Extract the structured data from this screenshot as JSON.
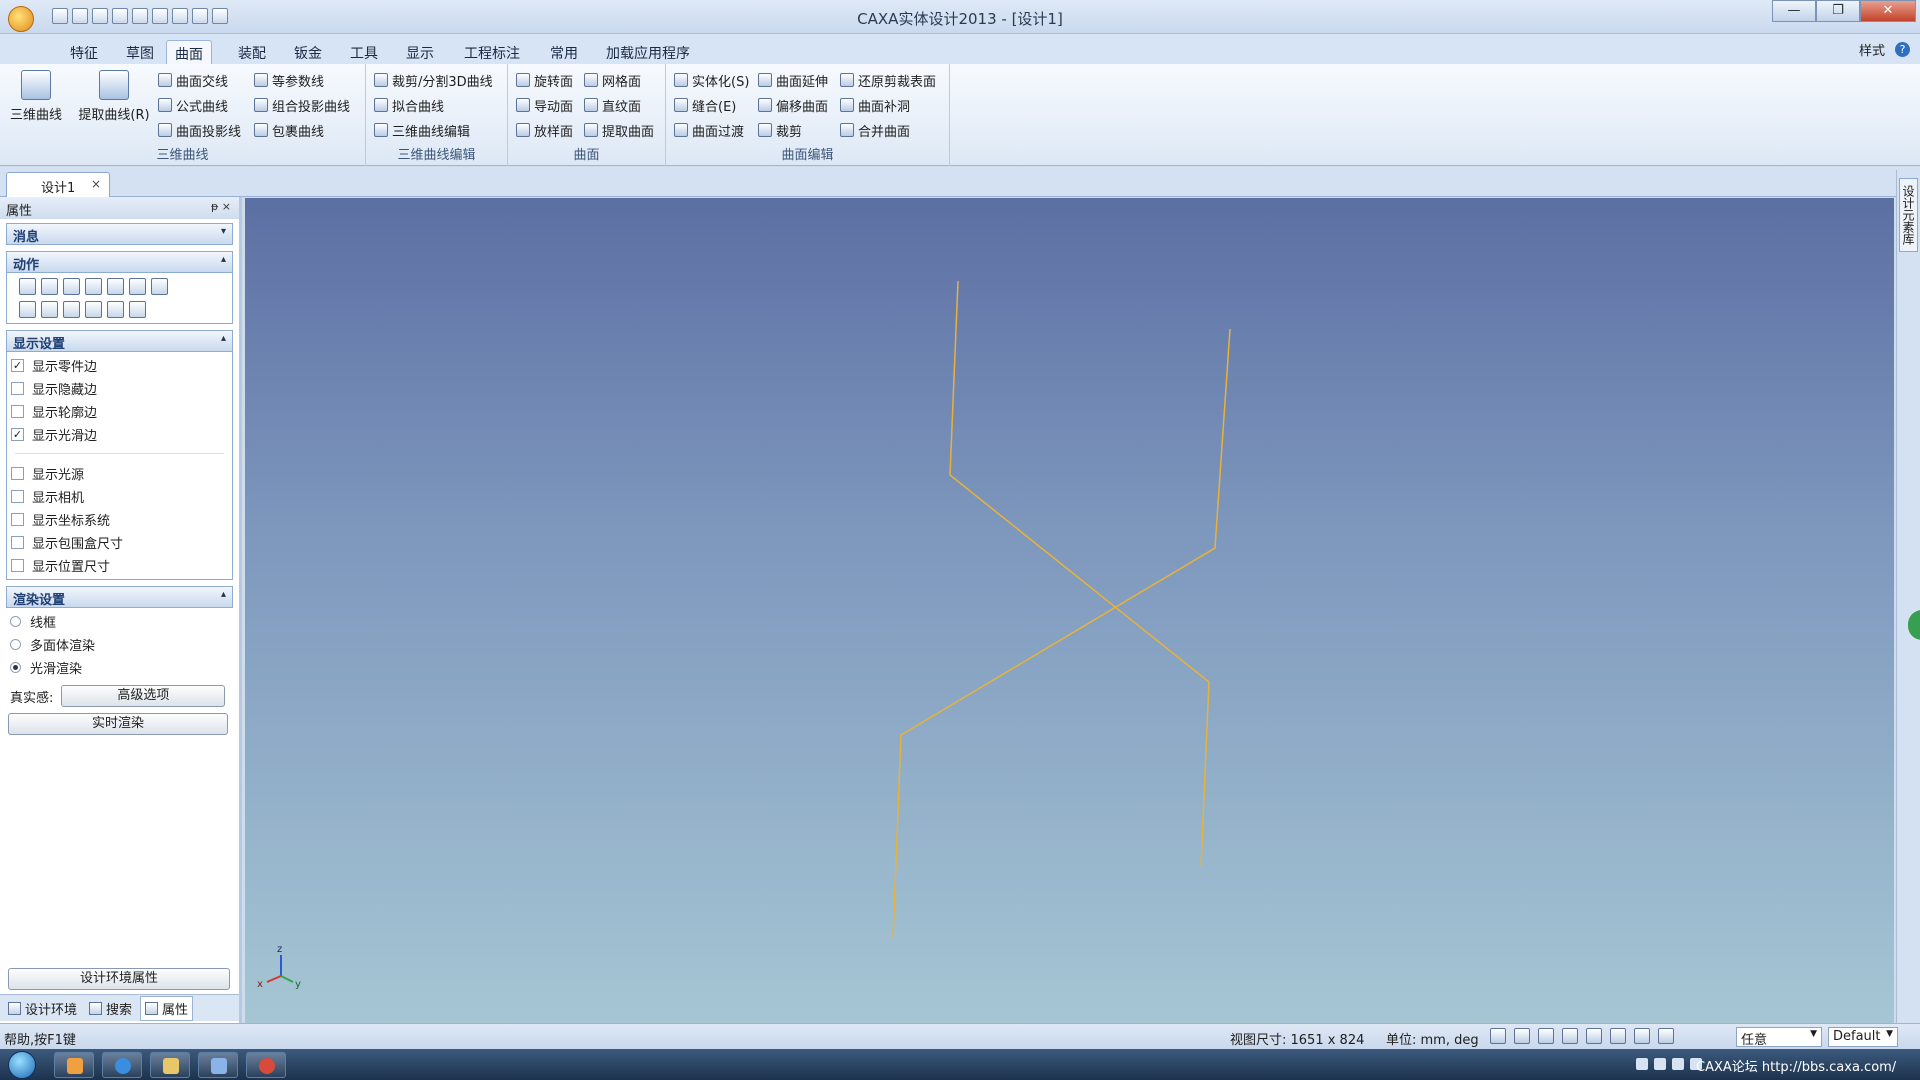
{
  "window": {
    "title": "CAXA实体设计2013 - [设计1]",
    "controls": {
      "minimize": "—",
      "maximize": "❐",
      "close": "✕"
    }
  },
  "ribbon": {
    "tabs": [
      "特征",
      "草图",
      "曲面",
      "装配",
      "钣金",
      "工具",
      "显示",
      "工程标注",
      "常用",
      "加载应用程序"
    ],
    "active_tab": "曲面",
    "right": {
      "style_label": "样式",
      "help": "?"
    },
    "groups": {
      "curve3d": {
        "title": "三维曲线",
        "big": [
          "三维曲线",
          "提取曲线(R)"
        ],
        "small": [
          "曲面交线",
          "等参数线",
          "公式曲线",
          "组合投影曲线",
          "曲面投影线",
          "包裹曲线"
        ]
      },
      "curve_edit": {
        "title": "三维曲线编辑",
        "small": [
          "裁剪/分割3D曲线",
          "拟合曲线",
          "三维曲线编辑"
        ]
      },
      "surface": {
        "title": "曲面",
        "small": [
          "旋转面",
          "网格面",
          "导动面",
          "直纹面",
          "放样面",
          "提取曲面"
        ]
      },
      "surface_edit": {
        "title": "曲面编辑",
        "small": [
          "实体化(S)",
          "曲面延伸",
          "还原剪裁表面",
          "缝合(E)",
          "偏移曲面",
          "曲面补洞",
          "曲面过渡",
          "裁剪",
          "合并曲面"
        ]
      }
    }
  },
  "doc_tab": {
    "label": "设计1",
    "close": "×"
  },
  "panel": {
    "title": "属性",
    "title_btns": "ᵽ ×",
    "sections": {
      "message": "消息",
      "action": "动作",
      "display": "显示设置",
      "render": "渲染设置"
    },
    "display_options": [
      {
        "label": "显示零件边",
        "checked": true
      },
      {
        "label": "显示隐藏边",
        "checked": false
      },
      {
        "label": "显示轮廓边",
        "checked": false
      },
      {
        "label": "显示光滑边",
        "checked": true
      },
      {
        "label": "显示光源",
        "checked": false
      },
      {
        "label": "显示相机",
        "checked": false
      },
      {
        "label": "显示坐标系统",
        "checked": false
      },
      {
        "label": "显示包围盒尺寸",
        "checked": false
      },
      {
        "label": "显示位置尺寸",
        "checked": false
      }
    ],
    "render_options": [
      {
        "label": "线框",
        "selected": false
      },
      {
        "label": "多面体渲染",
        "selected": false
      },
      {
        "label": "光滑渲染",
        "selected": true
      }
    ],
    "realism_label": "真实感:",
    "advanced_btn": "高级选项",
    "realtime_btn": "实时渲染",
    "env_props_btn": "设计环境属性",
    "bottom_tabs": [
      "设计环境",
      "搜索",
      "属性"
    ],
    "active_bottom_tab": "属性"
  },
  "right_dock": {
    "tab": "设计元素库"
  },
  "viewport": {
    "curve_color": "#e8b23a",
    "axes": {
      "x": "x",
      "y": "y",
      "z": "z"
    }
  },
  "status": {
    "help": "帮助,按F1键",
    "view_size": "视图尺寸: 1651 x  824",
    "units": "单位: mm, deg",
    "filter_value": "任意",
    "style_value": "Default"
  },
  "taskbar": {
    "tray_text": "CAXA论坛 http://bbs.caxa.com/"
  }
}
